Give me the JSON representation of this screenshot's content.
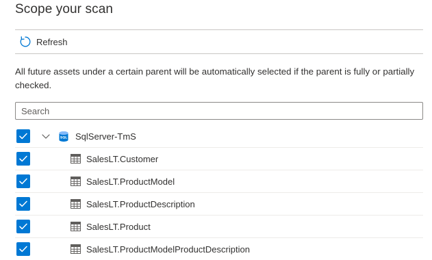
{
  "page": {
    "title": "Scope your scan"
  },
  "toolbar": {
    "refresh_label": "Refresh",
    "refresh_icon": "refresh-icon"
  },
  "description": "All future assets under a certain parent will be automatically selected if the parent is fully or partially checked.",
  "search": {
    "placeholder": "Search",
    "value": ""
  },
  "tree": {
    "parent": {
      "label": "SqlServer-TmS",
      "icon": "sql-database-icon",
      "checked": true,
      "expanded": true
    },
    "children": [
      {
        "label": "SalesLT.Customer",
        "icon": "table-icon",
        "checked": true
      },
      {
        "label": "SalesLT.ProductModel",
        "icon": "table-icon",
        "checked": true
      },
      {
        "label": "SalesLT.ProductDescription",
        "icon": "table-icon",
        "checked": true
      },
      {
        "label": "SalesLT.Product",
        "icon": "table-icon",
        "checked": true
      },
      {
        "label": "SalesLT.ProductModelProductDescription",
        "icon": "table-icon",
        "checked": true
      }
    ]
  },
  "colors": {
    "accent": "#0078d4",
    "text": "#323130",
    "divider": "#c8c6c4"
  }
}
